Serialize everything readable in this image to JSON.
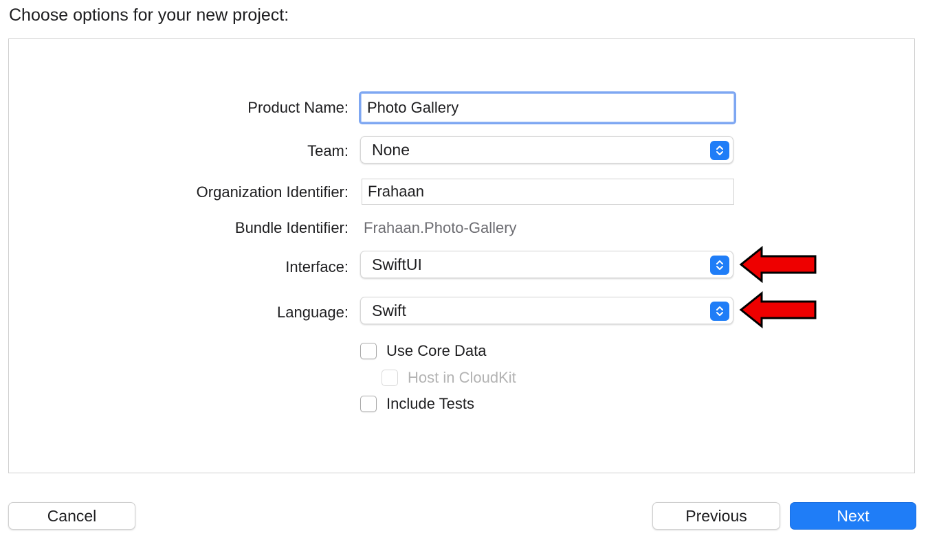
{
  "dialog": {
    "heading": "Choose options for your new project:"
  },
  "form": {
    "product_name": {
      "label": "Product Name:",
      "value": "Photo Gallery"
    },
    "team": {
      "label": "Team:",
      "value": "None"
    },
    "organization_identifier": {
      "label": "Organization Identifier:",
      "value": "Frahaan"
    },
    "bundle_identifier": {
      "label": "Bundle Identifier:",
      "value": "Frahaan.Photo-Gallery"
    },
    "interface": {
      "label": "Interface:",
      "value": "SwiftUI"
    },
    "language": {
      "label": "Language:",
      "value": "Swift"
    },
    "use_core_data": {
      "label": "Use Core Data",
      "checked": false
    },
    "host_in_cloudkit": {
      "label": "Host in CloudKit",
      "checked": false,
      "enabled": false
    },
    "include_tests": {
      "label": "Include Tests",
      "checked": false
    }
  },
  "footer": {
    "cancel_label": "Cancel",
    "previous_label": "Previous",
    "next_label": "Next"
  },
  "colors": {
    "accent": "#1f7df7",
    "focus_ring": "#7ea7f2",
    "annotation_arrow": "#ee0000"
  },
  "icons": {
    "popup_stepper": "chevron-up-down-icon",
    "annotation": "left-arrow-icon"
  }
}
